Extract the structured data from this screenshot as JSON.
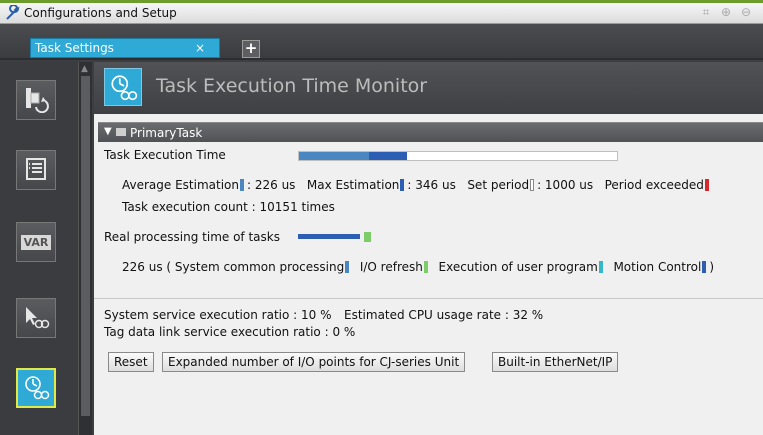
{
  "window": {
    "title": "Configurations and Setup"
  },
  "tabs": [
    {
      "label": "Task Settings",
      "active": true
    }
  ],
  "page": {
    "title": "Task Execution Time Monitor"
  },
  "section": {
    "label": "PrimaryTask"
  },
  "execution": {
    "label": "Task Execution Time",
    "bar": {
      "average_fraction": 0.22,
      "max_fraction": 0.34,
      "accent_avg": "#4a86c0",
      "accent_max": "#2c5fb3"
    },
    "average_label": "Average Estimation",
    "average_value": ": 226 us",
    "max_label": "Max Estimation",
    "max_value": ": 346 us",
    "set_period_label": "Set period",
    "set_period_value": ": 1000 us",
    "period_exceeded_label": "Period exceeded",
    "count_text": "Task execution count : 10151 times"
  },
  "realtime": {
    "label": "Real processing time of tasks",
    "value_text": "226 us ( System common processing",
    "io_label": "I/O refresh",
    "user_label": "Execution of user program",
    "motion_label": "Motion Control",
    "close_paren": ")"
  },
  "ratios": {
    "system_service": "System service execution ratio : 10 %",
    "cpu_usage": "Estimated CPU usage rate : 32 %",
    "tag_data_link": "Tag data link service execution ratio : 0 %"
  },
  "buttons": {
    "reset": "Reset",
    "expanded": "Expanded number of I/O points for CJ-series Unit",
    "ethernet": "Built-in EtherNet/IP"
  },
  "colors": {
    "accent": "#2fa9d6",
    "exceeded": "#d6262e",
    "io_refresh": "#7ccc6a",
    "user_program": "#34b7c9",
    "motion": "#2c5fb3"
  },
  "sidebar": {
    "icons": [
      "rebuild-icon",
      "list-icon",
      "var-icon",
      "cursor-task-icon",
      "task-monitor-icon"
    ],
    "var_label": "VAR"
  }
}
